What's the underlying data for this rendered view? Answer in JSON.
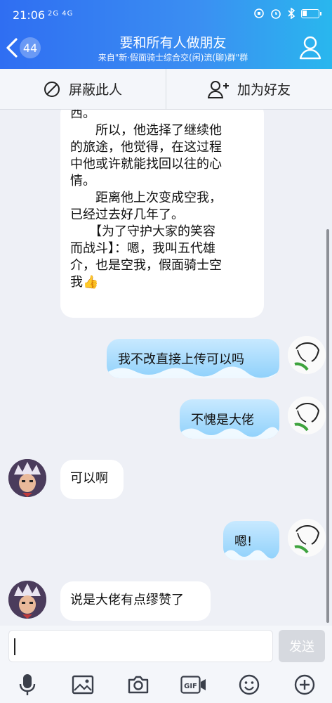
{
  "status_bar": {
    "time": "21:06",
    "signal": "2G 4G",
    "icons": [
      "alarm-icon",
      "clock-icon",
      "bluetooth-icon",
      "battery-icon"
    ]
  },
  "header": {
    "back_badge": "44",
    "title": "要和所有人做朋友",
    "subtitle": "来自\"新·假面骑士综合交(闲)流(聊)群\"群"
  },
  "actions": {
    "block_label": "屏蔽此人",
    "add_friend_label": "加为好友"
  },
  "messages": {
    "long_text": "西。\n　　所以，他选择了继续他\n的旅途，他觉得，在这过程\n中他或许就能找回以往的心\n情。\n　　距离他上次变成空我，\n已经过去好几年了。\n　　【为了守护大家的笑容\n而战斗】：嗯，我叫五代雄\n介，也是空我，假面骑士空\n我👍",
    "m1": "我不改直接上传可以吗",
    "m2": "不愧是大佬",
    "m3": "可以啊",
    "m4": "嗯!",
    "m5": "说是大佬有点缪赞了"
  },
  "input": {
    "send_label": "发送",
    "gif_label": "GIF"
  },
  "colors": {
    "header_start": "#2f6ef2",
    "header_end": "#29b7ee",
    "bubble_right": "#8fd1fb",
    "background": "#eef0f6"
  }
}
